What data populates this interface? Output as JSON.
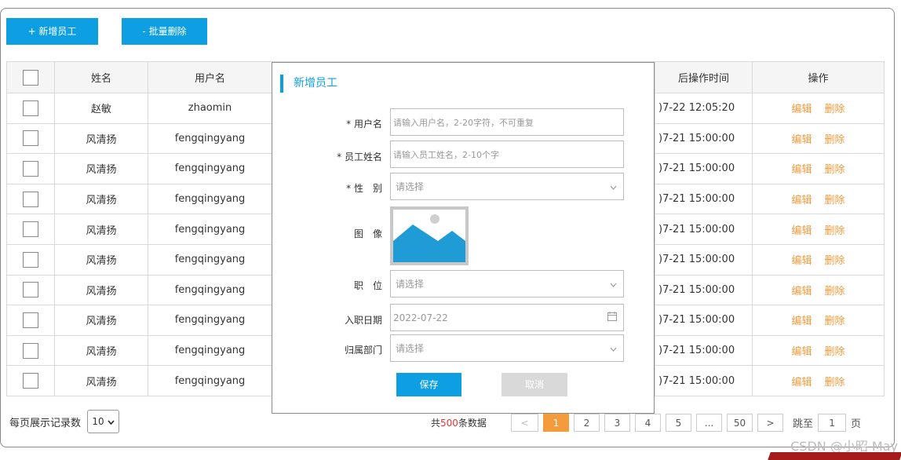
{
  "toolbar": {
    "add_label": "+ 新增员工",
    "batch_delete_label": "- 批量删除"
  },
  "table": {
    "headers": [
      "姓名",
      "用户名",
      "后操作时间",
      "操作"
    ],
    "edit_label": "编辑",
    "delete_label": "删除",
    "rows": [
      {
        "name": "赵敏",
        "username": "zhaomin",
        "time": ")7-22 12:05:20"
      },
      {
        "name": "风清扬",
        "username": "fengqingyang",
        "time": ")7-21 15:00:00"
      },
      {
        "name": "风清扬",
        "username": "fengqingyang",
        "time": ")7-21 15:00:00"
      },
      {
        "name": "风清扬",
        "username": "fengqingyang",
        "time": ")7-21 15:00:00"
      },
      {
        "name": "风清扬",
        "username": "fengqingyang",
        "time": ")7-21 15:00:00"
      },
      {
        "name": "风清扬",
        "username": "fengqingyang",
        "time": ")7-21 15:00:00"
      },
      {
        "name": "风清扬",
        "username": "fengqingyang",
        "time": ")7-21 15:00:00"
      },
      {
        "name": "风清扬",
        "username": "fengqingyang",
        "time": ")7-21 15:00:00"
      },
      {
        "name": "风清扬",
        "username": "fengqingyang",
        "time": ")7-21 15:00:00"
      },
      {
        "name": "风清扬",
        "username": "fengqingyang",
        "time": ")7-21 15:00:00"
      }
    ]
  },
  "pagination": {
    "page_size_label": "每页展示记录数",
    "page_size": "10",
    "total_prefix": "共",
    "total": "500",
    "total_suffix": "条数据",
    "prev": "<",
    "next": ">",
    "pages": [
      "1",
      "2",
      "3",
      "4",
      "5",
      "...",
      "50"
    ],
    "current": "1",
    "goto_label": "跳至",
    "goto_value": "1",
    "goto_suffix": "页"
  },
  "modal": {
    "title": "新增员工",
    "fields": {
      "username": {
        "label": "* 用户名",
        "placeholder": "请输入用户名，2-20字符，不可重复"
      },
      "realname": {
        "label": "* 员工姓名",
        "placeholder": "请输入员工姓名，2-10个字"
      },
      "gender": {
        "label": "* 性　别",
        "placeholder": "请选择"
      },
      "image": {
        "label": "图　像"
      },
      "position": {
        "label": "职　位",
        "placeholder": "请选择"
      },
      "entry_date": {
        "label": "入职日期",
        "value": "2022-07-22"
      },
      "department": {
        "label": "归属部门",
        "placeholder": "请选择"
      }
    },
    "save_label": "保存",
    "cancel_label": "取消"
  },
  "watermark": "CSDN @小昭 May",
  "colors": {
    "primary": "#0e9fe3",
    "accent": "#f49b3c",
    "total_red": "#e53333"
  }
}
